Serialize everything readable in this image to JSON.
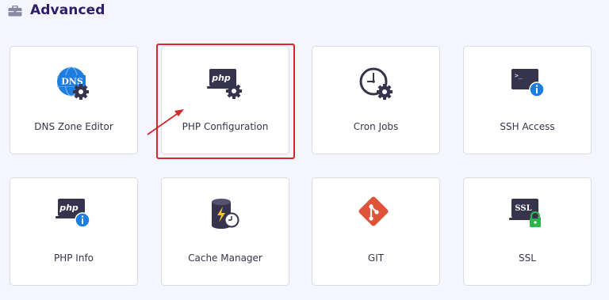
{
  "section": {
    "title": "Advanced",
    "icon": "briefcase-icon"
  },
  "tiles": [
    {
      "label": "DNS Zone Editor",
      "icon": "dns-gear-icon"
    },
    {
      "label": "PHP Configuration",
      "icon": "php-gear-icon"
    },
    {
      "label": "Cron Jobs",
      "icon": "clock-gear-icon"
    },
    {
      "label": "SSH Access",
      "icon": "terminal-info-icon"
    },
    {
      "label": "PHP Info",
      "icon": "php-info-icon"
    },
    {
      "label": "Cache Manager",
      "icon": "database-lightning-clock-icon"
    },
    {
      "label": "GIT",
      "icon": "git-icon"
    },
    {
      "label": "SSL",
      "icon": "ssl-lock-icon"
    }
  ],
  "icon_texts": {
    "dns": "DNS",
    "php": "php",
    "terminal": ">_",
    "ssl": "SSL"
  },
  "annotation": {
    "highlighted_tile": "PHP Configuration",
    "color": "#d02a2a"
  },
  "colors": {
    "title": "#2f1c6a",
    "icon_dark": "#36344d",
    "accent_blue": "#1f7de0",
    "git_orange": "#e0533b",
    "lock_green": "#2fb34a"
  }
}
